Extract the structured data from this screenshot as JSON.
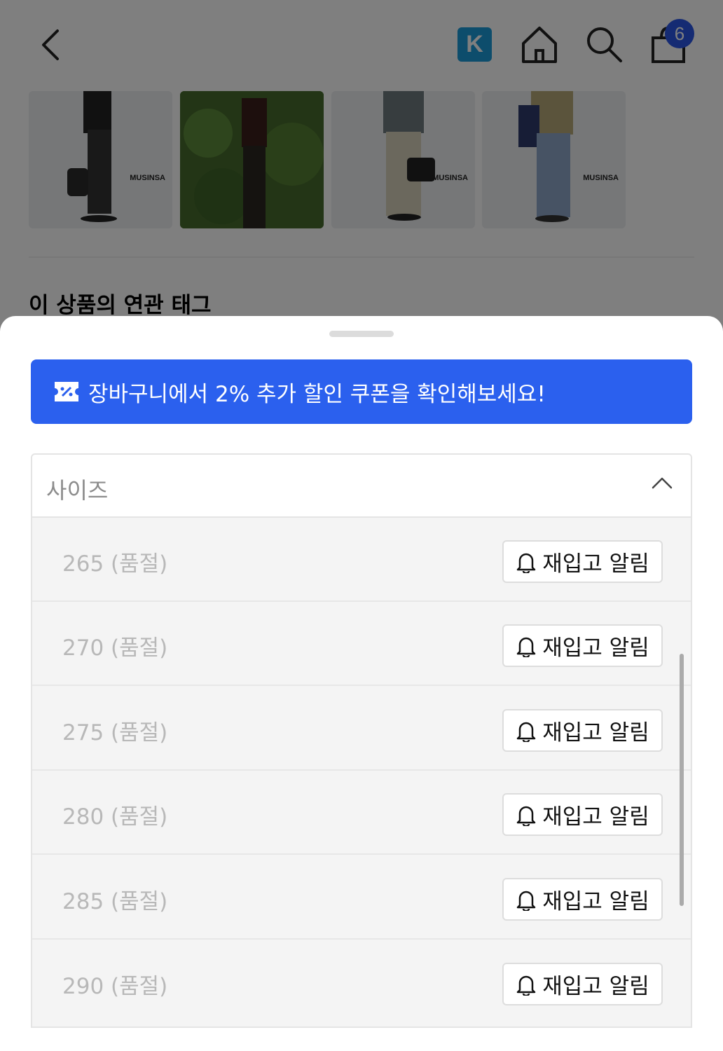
{
  "header": {
    "k_badge": "K",
    "cart_count": "6"
  },
  "thumbnails": [
    {
      "brand": "MUSINSA"
    },
    {
      "brand": ""
    },
    {
      "brand": "MUSINSA"
    },
    {
      "brand": "MUSINSA"
    }
  ],
  "section": {
    "tags_title": "이 상품의 연관 태그"
  },
  "sheet": {
    "coupon_banner": "장바구니에서 2% 추가 할인 쿠폰을 확인해보세요!",
    "size_select": {
      "label": "사이즈",
      "options": [
        {
          "label": "265 (품절)",
          "button": "재입고 알림"
        },
        {
          "label": "270 (품절)",
          "button": "재입고 알림"
        },
        {
          "label": "275 (품절)",
          "button": "재입고 알림"
        },
        {
          "label": "280 (품절)",
          "button": "재입고 알림"
        },
        {
          "label": "285 (품절)",
          "button": "재입고 알림"
        },
        {
          "label": "290 (품절)",
          "button": "재입고 알림"
        }
      ]
    }
  },
  "colors": {
    "accent_blue": "#2b60ee",
    "badge_blue": "#2a56e6",
    "k_badge": "#1a9bd8"
  },
  "icons": [
    "back-icon",
    "k-logo-icon",
    "home-icon",
    "search-icon",
    "cart-icon",
    "coupon-icon",
    "chevron-up-icon",
    "bell-icon"
  ]
}
